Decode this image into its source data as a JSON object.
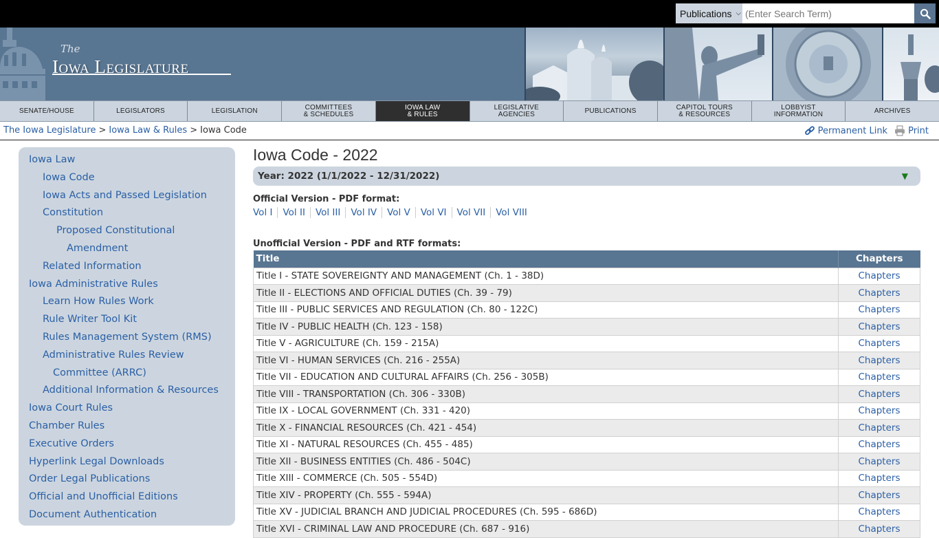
{
  "search": {
    "scope_selected": "Publications",
    "placeholder": "(Enter Search Term)",
    "value": ""
  },
  "banner": {
    "logo_the": "The",
    "logo_main": "Iowa Legislature"
  },
  "nav": [
    {
      "line1": "SENATE/HOUSE",
      "line2": ""
    },
    {
      "line1": "LEGISLATORS",
      "line2": ""
    },
    {
      "line1": "LEGISLATION",
      "line2": ""
    },
    {
      "line1": "COMMITTEES",
      "line2": "& SCHEDULES"
    },
    {
      "line1": "IOWA LAW",
      "line2": "& RULES"
    },
    {
      "line1": "LEGISLATIVE",
      "line2": "AGENCIES"
    },
    {
      "line1": "PUBLICATIONS",
      "line2": ""
    },
    {
      "line1": "CAPITOL TOURS",
      "line2": "& RESOURCES"
    },
    {
      "line1": "LOBBYIST",
      "line2": "INFORMATION"
    },
    {
      "line1": "ARCHIVES",
      "line2": ""
    }
  ],
  "nav_active_index": 4,
  "breadcrumb": {
    "items": [
      "The Iowa Legislature",
      "Iowa Law & Rules",
      "Iowa Code"
    ],
    "separator": ">"
  },
  "tools": {
    "permanent_link": "Permanent Link",
    "print": "Print"
  },
  "sidebar": [
    {
      "label": "Iowa Law",
      "level": "lvl0"
    },
    {
      "label": "Iowa Code",
      "level": "lvl1"
    },
    {
      "label": "Iowa Acts and Passed Legislation",
      "level": "lvl1"
    },
    {
      "label": "Constitution",
      "level": "lvl1"
    },
    {
      "label": "Proposed Constitutional",
      "level": "lvl2"
    },
    {
      "label": "Amendment",
      "level": "lvl2b"
    },
    {
      "label": "Related Information",
      "level": "lvl1"
    },
    {
      "label": "Iowa Administrative Rules",
      "level": "lvl0"
    },
    {
      "label": "Learn How Rules Work",
      "level": "lvl1"
    },
    {
      "label": "Rule Writer Tool Kit",
      "level": "lvl1"
    },
    {
      "label": "Rules Management System (RMS)",
      "level": "lvl1"
    },
    {
      "label": "Administrative Rules Review",
      "level": "lvl1"
    },
    {
      "label": "Committee (ARRC)",
      "level": "lvl1b"
    },
    {
      "label": "Additional Information & Resources",
      "level": "lvl1"
    },
    {
      "label": "Iowa Court Rules",
      "level": "lvl0"
    },
    {
      "label": "Chamber Rules",
      "level": "lvl0"
    },
    {
      "label": "Executive Orders",
      "level": "lvl0"
    },
    {
      "label": "Hyperlink Legal Downloads",
      "level": "lvl0"
    },
    {
      "label": "Order Legal Publications",
      "level": "lvl0"
    },
    {
      "label": "Official and Unofficial Editions",
      "level": "lvl0"
    },
    {
      "label": "Document Authentication",
      "level": "lvl0"
    }
  ],
  "main": {
    "title": "Iowa Code - 2022",
    "year_selector": "Year: 2022 (1/1/2022 - 12/31/2022)",
    "official_label": "Official Version - PDF format:",
    "volumes": [
      "Vol I",
      "Vol II",
      "Vol III",
      "Vol IV",
      "Vol V",
      "Vol VI",
      "Vol VII",
      "Vol VIII"
    ],
    "unofficial_label": "Unofficial Version - PDF and RTF formats:",
    "table": {
      "headers": [
        "Title",
        "Chapters"
      ],
      "rows": [
        {
          "title": "Title I - STATE SOVEREIGNTY AND MANAGEMENT (Ch. 1 - 38D)",
          "link": "Chapters"
        },
        {
          "title": "Title II - ELECTIONS AND OFFICIAL DUTIES (Ch. 39 - 79)",
          "link": "Chapters"
        },
        {
          "title": "Title III - PUBLIC SERVICES AND REGULATION (Ch. 80 - 122C)",
          "link": "Chapters"
        },
        {
          "title": "Title IV - PUBLIC HEALTH (Ch. 123 - 158)",
          "link": "Chapters"
        },
        {
          "title": "Title V - AGRICULTURE (Ch. 159 - 215A)",
          "link": "Chapters"
        },
        {
          "title": "Title VI - HUMAN SERVICES (Ch. 216 - 255A)",
          "link": "Chapters"
        },
        {
          "title": "Title VII - EDUCATION AND CULTURAL AFFAIRS (Ch. 256 - 305B)",
          "link": "Chapters"
        },
        {
          "title": "Title VIII - TRANSPORTATION (Ch. 306 - 330B)",
          "link": "Chapters"
        },
        {
          "title": "Title IX - LOCAL GOVERNMENT (Ch. 331 - 420)",
          "link": "Chapters"
        },
        {
          "title": "Title X - FINANCIAL RESOURCES (Ch. 421 - 454)",
          "link": "Chapters"
        },
        {
          "title": "Title XI - NATURAL RESOURCES (Ch. 455 - 485)",
          "link": "Chapters"
        },
        {
          "title": "Title XII - BUSINESS ENTITIES (Ch. 486 - 504C)",
          "link": "Chapters"
        },
        {
          "title": "Title XIII - COMMERCE (Ch. 505 - 554D)",
          "link": "Chapters"
        },
        {
          "title": "Title XIV - PROPERTY (Ch. 555 - 594A)",
          "link": "Chapters"
        },
        {
          "title": "Title XV - JUDICIAL BRANCH AND JUDICIAL PROCEDURES (Ch. 595 - 686D)",
          "link": "Chapters"
        },
        {
          "title": "Title XVI - CRIMINAL LAW AND PROCEDURE (Ch. 687 - 916)",
          "link": "Chapters"
        }
      ]
    }
  },
  "colors": {
    "brand_blue": "#587591",
    "nav_bg": "#ccd5df",
    "nav_active": "#2f2f2f",
    "link": "#2a5fa5",
    "year_arrow": "#1a7a1a"
  }
}
